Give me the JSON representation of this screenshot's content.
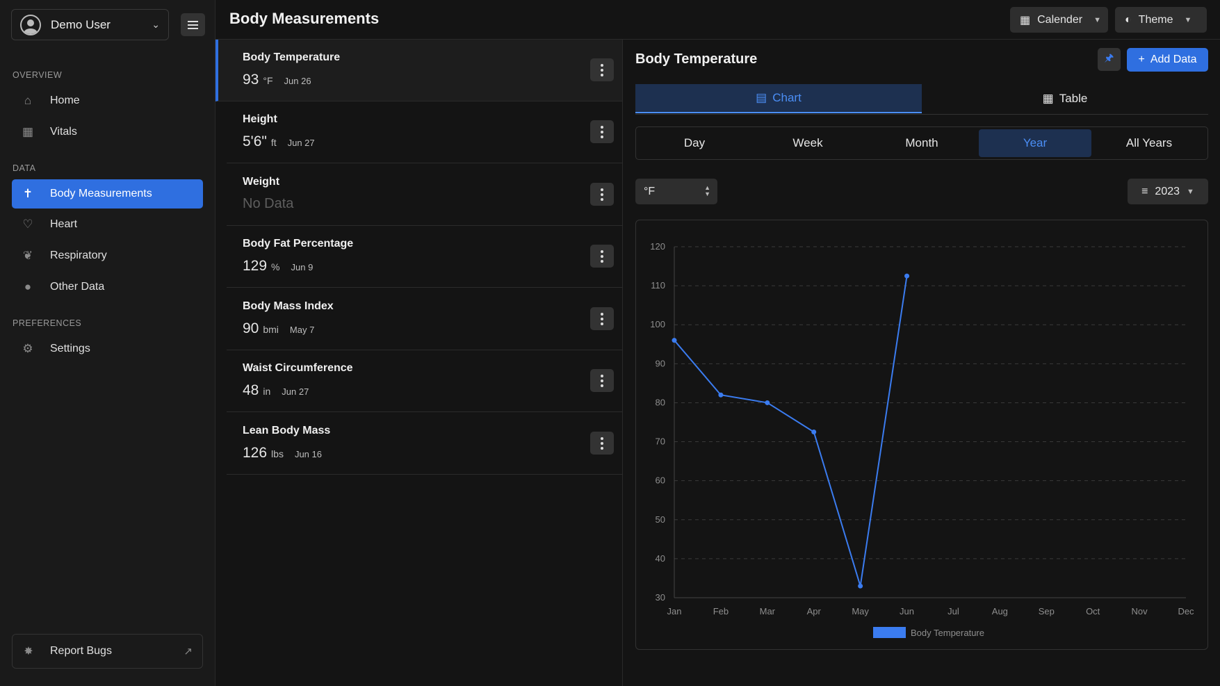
{
  "sidebar": {
    "user_name": "Demo User",
    "sections": {
      "overview": "OVERVIEW",
      "data": "DATA",
      "preferences": "PREFERENCES"
    },
    "items": [
      {
        "label": "Home",
        "icon": "home-icon"
      },
      {
        "label": "Vitals",
        "icon": "vitals-icon"
      },
      {
        "label": "Body Measurements",
        "icon": "body-icon",
        "active": true
      },
      {
        "label": "Heart",
        "icon": "heart-icon"
      },
      {
        "label": "Respiratory",
        "icon": "lungs-icon"
      },
      {
        "label": "Other Data",
        "icon": "location-icon"
      },
      {
        "label": "Settings",
        "icon": "gear-icon"
      }
    ],
    "report_bugs": "Report Bugs"
  },
  "header": {
    "title": "Body Measurements",
    "calendar_label": "Calender",
    "theme_label": "Theme"
  },
  "measurements": [
    {
      "title": "Body Temperature",
      "value": "93",
      "unit": "°F",
      "date": "Jun 26",
      "active": true
    },
    {
      "title": "Height",
      "value": "5'6\"",
      "unit": "ft",
      "date": "Jun 27"
    },
    {
      "title": "Weight",
      "nodata": "No Data"
    },
    {
      "title": "Body Fat Percentage",
      "value": "129",
      "unit": "%",
      "date": "Jun 9"
    },
    {
      "title": "Body Mass Index",
      "value": "90",
      "unit": "bmi",
      "date": "May 7"
    },
    {
      "title": "Waist Circumference",
      "value": "48",
      "unit": "in",
      "date": "Jun 27"
    },
    {
      "title": "Lean Body Mass",
      "value": "126",
      "unit": "lbs",
      "date": "Jun 16"
    }
  ],
  "detail": {
    "title": "Body Temperature",
    "add_label": "Add Data",
    "tabs": {
      "chart": "Chart",
      "table": "Table"
    },
    "ranges": [
      "Day",
      "Week",
      "Month",
      "Year",
      "All Years"
    ],
    "active_range": "Year",
    "unit_select": "°F",
    "year": "2023"
  },
  "colors": {
    "accent": "#2f6fe0",
    "line": "#3b7cf0",
    "active_tab_bg": "#1d3050"
  },
  "chart_data": {
    "type": "line",
    "categories": [
      "Jan",
      "Feb",
      "Mar",
      "Apr",
      "May",
      "Jun",
      "Jul",
      "Aug",
      "Sep",
      "Oct",
      "Nov",
      "Dec"
    ],
    "series": [
      {
        "name": "Body Temperature",
        "values": [
          96,
          82,
          80,
          72.5,
          33,
          112.5,
          null,
          null,
          null,
          null,
          null,
          null
        ]
      }
    ],
    "ylim": [
      30,
      120
    ],
    "yticks": [
      30,
      40,
      50,
      60,
      70,
      80,
      90,
      100,
      110,
      120
    ],
    "grid": true,
    "legend": "bottom"
  }
}
